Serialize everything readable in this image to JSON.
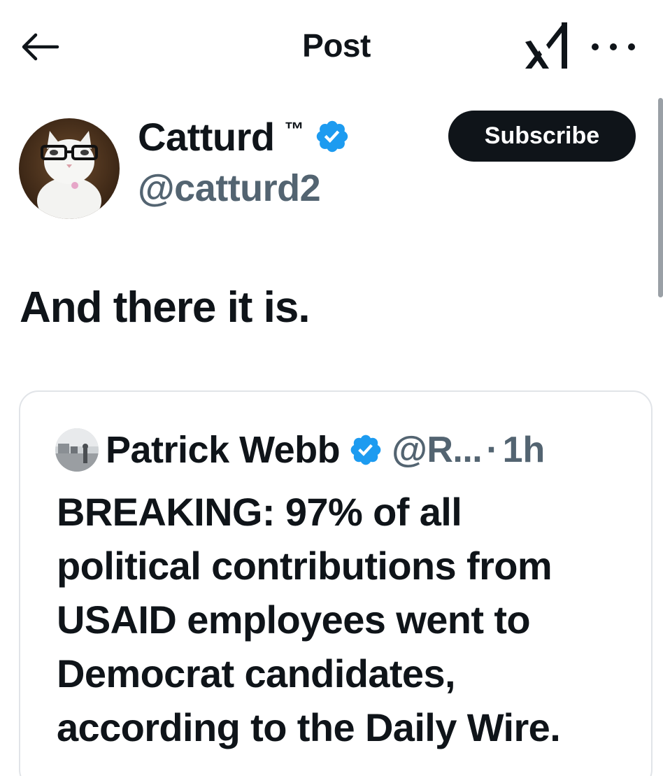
{
  "topbar": {
    "title": "Post",
    "back_icon": "arrow-left-icon",
    "grok_icon": "grok-logo-icon",
    "more_icon": "more-horizontal-icon"
  },
  "author": {
    "name": "Catturd",
    "trademark": "™",
    "handle": "@catturd2",
    "verified_icon": "verified-badge-icon",
    "subscribe_label": "Subscribe"
  },
  "post": {
    "text": "And there it is."
  },
  "quoted_post": {
    "name": "Patrick Webb",
    "handle": "@R...",
    "separator": "·",
    "time": "1h",
    "lines": [
      "BREAKING: 97% of all",
      "political contributions from",
      "USAID employees went to",
      "Democrat candidates,",
      "according to the Daily Wire."
    ]
  },
  "colors": {
    "text": "#0f1419",
    "secondary": "#536471",
    "verified": "#1d9bf0",
    "border": "#e1e4e8"
  }
}
